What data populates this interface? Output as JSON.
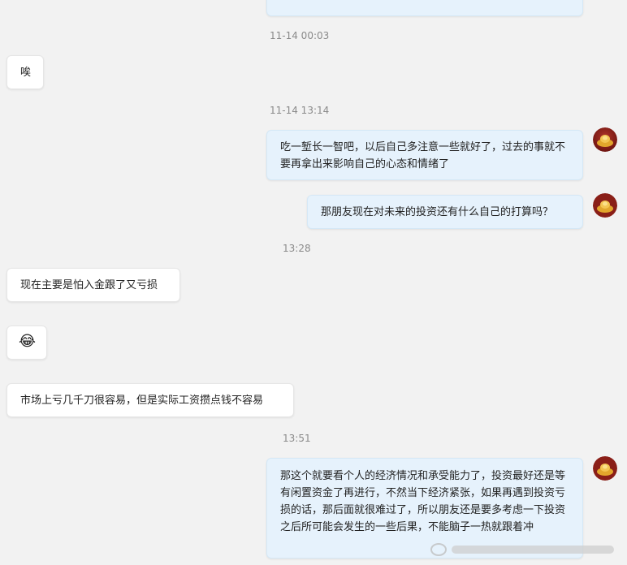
{
  "messages": [
    {
      "side": "right",
      "text": "",
      "cut": true
    },
    {
      "timestamp": "11-14 00:03"
    },
    {
      "side": "left",
      "text": "唉"
    },
    {
      "timestamp": "11-14 13:14"
    },
    {
      "side": "right",
      "text": "吃一堑长一智吧，以后自己多注意一些就好了，过去的事就不要再拿出来影响自己的心态和情绪了"
    },
    {
      "side": "right",
      "text": "那朋友现在对未来的投资还有什么自己的打算吗？"
    },
    {
      "timestamp": "13:28"
    },
    {
      "side": "left",
      "text": "现在主要是怕入金跟了又亏损"
    },
    {
      "side": "left",
      "emoji": "😂"
    },
    {
      "side": "left",
      "text": "市场上亏几千刀很容易，但是实际工资攒点钱不容易"
    },
    {
      "timestamp": "13:51"
    },
    {
      "side": "right",
      "text": "那这个就要看个人的经济情况和承受能力了，投资最好还是等有闲置资金了再进行，不然当下经济紧张，如果再遇到投资亏损的话，那后面就很难过了，所以朋友还是要多考虑一下投资之后所可能会发生的一些后果，不能脑子一热就跟着冲"
    }
  ],
  "timestamps": {
    "t1": "11-14 00:03",
    "t2": "11-14 13:14",
    "t3": "13:28",
    "t4": "13:51"
  },
  "left_msgs": {
    "m1": "唉",
    "m2": "现在主要是怕入金跟了又亏损",
    "m3_emoji": "😂",
    "m4": "市场上亏几千刀很容易，但是实际工资攒点钱不容易"
  },
  "right_msgs": {
    "m1": "吃一堑长一智吧，以后自己多注意一些就好了，过去的事就不要再拿出来影响自己的心态和情绪了",
    "m2": "那朋友现在对未来的投资还有什么自己的打算吗？",
    "m3": "那这个就要看个人的经济情况和承受能力了，投资最好还是等有闲置资金了再进行，不然当下经济紧张，如果再遇到投资亏损的话，那后面就很难过了，所以朋友还是要多考虑一下投资之后所可能会发生的一些后果，不能脑子一热就跟着冲"
  },
  "avatar_icon": "gold-ingot-avatar-icon",
  "colors": {
    "background": "#f2f2f2",
    "right_bubble": "#e6f2fc",
    "left_bubble": "#ffffff",
    "timestamp_text": "#8a8a8a"
  }
}
